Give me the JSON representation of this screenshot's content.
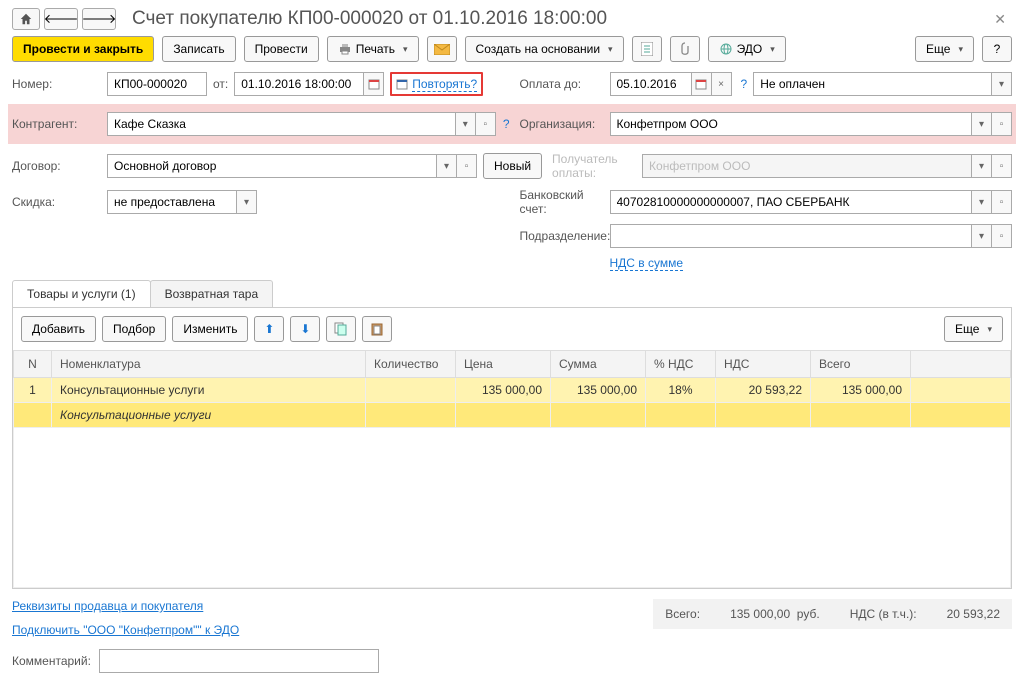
{
  "title": "Счет покупателю КП00-000020 от 01.10.2016 18:00:00",
  "toolbar": {
    "post_close": "Провести и закрыть",
    "save": "Записать",
    "post": "Провести",
    "print": "Печать",
    "create_based": "Создать на основании",
    "edo": "ЭДО",
    "more": "Еще"
  },
  "row1": {
    "number_label": "Номер:",
    "number": "КП00-000020",
    "from_label": "от:",
    "date": "01.10.2016 18:00:00",
    "repeat": "Повторять?",
    "pay_until_label": "Оплата до:",
    "pay_until": "05.10.2016",
    "status": "Не оплачен"
  },
  "row2": {
    "counterparty_label": "Контрагент:",
    "counterparty": "Кафе Сказка",
    "org_label": "Организация:",
    "org": "Конфетпром ООО"
  },
  "row3": {
    "contract_label": "Договор:",
    "contract": "Основной договор",
    "new_btn": "Новый",
    "payee_label": "Получатель оплаты:",
    "payee": "Конфетпром ООО"
  },
  "row4": {
    "discount_label": "Скидка:",
    "discount": "не предоставлена",
    "bank_label": "Банковский счет:",
    "bank": "40702810000000000007, ПАО СБЕРБАНК"
  },
  "row5": {
    "division_label": "Подразделение:",
    "division": ""
  },
  "vat_link": "НДС в сумме",
  "tabs": {
    "goods": "Товары и услуги (1)",
    "tara": "Возвратная тара"
  },
  "tab_toolbar": {
    "add": "Добавить",
    "select": "Подбор",
    "change": "Изменить",
    "more": "Еще"
  },
  "columns": {
    "n": "N",
    "nomen": "Номенклатура",
    "qty": "Количество",
    "price": "Цена",
    "sum": "Сумма",
    "vat_pct": "% НДС",
    "vat": "НДС",
    "total": "Всего"
  },
  "rows": [
    {
      "n": "1",
      "nomen": "Консультационные услуги",
      "qty": "",
      "price": "135 000,00",
      "sum": "135 000,00",
      "vat_pct": "18%",
      "vat": "20 593,22",
      "total": "135 000,00",
      "sub": "Консультационные услуги"
    }
  ],
  "footer": {
    "link_seller": "Реквизиты продавца и покупателя",
    "link_edo": "Подключить \"ООО \"Конфетпром\"\" к ЭДО",
    "total_label": "Всего:",
    "total": "135 000,00",
    "currency": "руб.",
    "vat_label": "НДС (в т.ч.):",
    "vat": "20 593,22",
    "comment_label": "Комментарий:",
    "comment": ""
  }
}
